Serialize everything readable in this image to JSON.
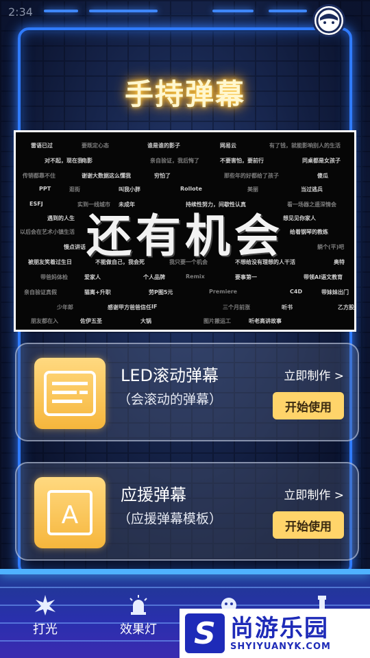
{
  "status_bar": {
    "time": "2:34"
  },
  "page": {
    "title": "手持弹幕"
  },
  "preview": {
    "big_text": "还有机会",
    "scroll_lines": [
      "雷语已过",
      "要既定心态",
      "谁是谁的影子",
      "网易云",
      "有了钱，就能影响别人的生活",
      "对不起，现在我",
      "电影",
      "亲自验证，我后悔了",
      "不要害怕，要前行",
      "同桌都是女孩子",
      "传销都靠不住",
      "谢谢大数据这么懂我",
      "穷怕了",
      "那些年的好都给了孩子",
      "傻瓜",
      "PPT",
      "逛街",
      "叫我小胖",
      "Rollote",
      "美丽",
      "当过逃兵",
      "ESFJ",
      "实到一线城市",
      "未成年",
      "持续性努力，间歇性认真",
      "看一场器之遥深情会",
      "遇到的人生",
      "想见见你家人",
      "以后会在艺术小镇生活",
      "给着钢琴的教练",
      "慢点讲话",
      "躺个(平)吧",
      "被朋友笑着过生日",
      "不能做自己，我会死",
      "我只要一个机会",
      "不想给没有理想的人干活",
      "奥特",
      "带爸妈体检",
      "爱家人",
      "个人品牌",
      "Remix",
      "要事第一",
      "带领AI语文教育",
      "亲自验证真假",
      "猫离+升职",
      "劳P图5元",
      "Premiere",
      "C4D",
      "带妹妹出门",
      "少年郎",
      "感谢甲方爸爸信任",
      "IF",
      "三个月前涨",
      "听书",
      "乙方股不敢做到",
      "朋友都在入",
      "佐伊五圣",
      "大锅",
      "图片搬运工",
      "听老高讲故事"
    ]
  },
  "cards": [
    {
      "title": "LED滚动弹幕",
      "subtitle": "（会滚动的弹幕）",
      "link": "立即制作 >",
      "button": "开始使用",
      "icon": "led-scroll-icon"
    },
    {
      "title": "应援弹幕",
      "subtitle": "（应援弹幕模板）",
      "link": "立即制作 >",
      "button": "开始使用",
      "icon": "letter-a-icon",
      "icon_letter": "A"
    }
  ],
  "nav": [
    {
      "label": "打光",
      "icon": "spark-icon"
    },
    {
      "label": "效果灯",
      "icon": "siren-icon"
    },
    {
      "label": "",
      "icon": "bubble-icon"
    },
    {
      "label": "",
      "icon": "lamp-icon"
    }
  ],
  "watermark": {
    "logo_letter": "S",
    "cn": "尚游乐园",
    "en": "SHYIYUANYK.COM"
  },
  "colors": {
    "neon_blue": "#2f7bff",
    "title_glow": "#f4a623",
    "button_yellow": "#ffd46a",
    "watermark_blue": "#1e2bb8"
  }
}
